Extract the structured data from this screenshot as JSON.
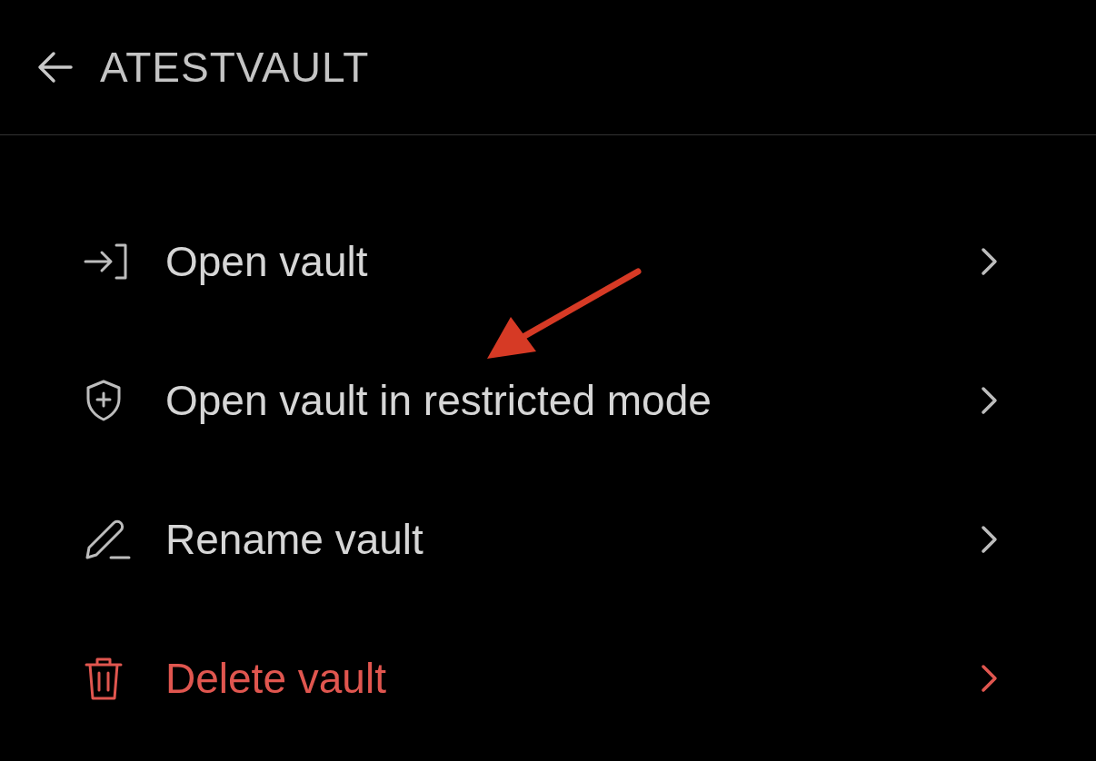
{
  "header": {
    "title": "ATESTVAULT"
  },
  "menu": [
    {
      "kind": "open",
      "label": "Open vault"
    },
    {
      "kind": "restricted",
      "label": "Open vault in restricted mode"
    },
    {
      "kind": "rename",
      "label": "Rename vault"
    },
    {
      "kind": "delete",
      "label": "Delete vault"
    }
  ]
}
